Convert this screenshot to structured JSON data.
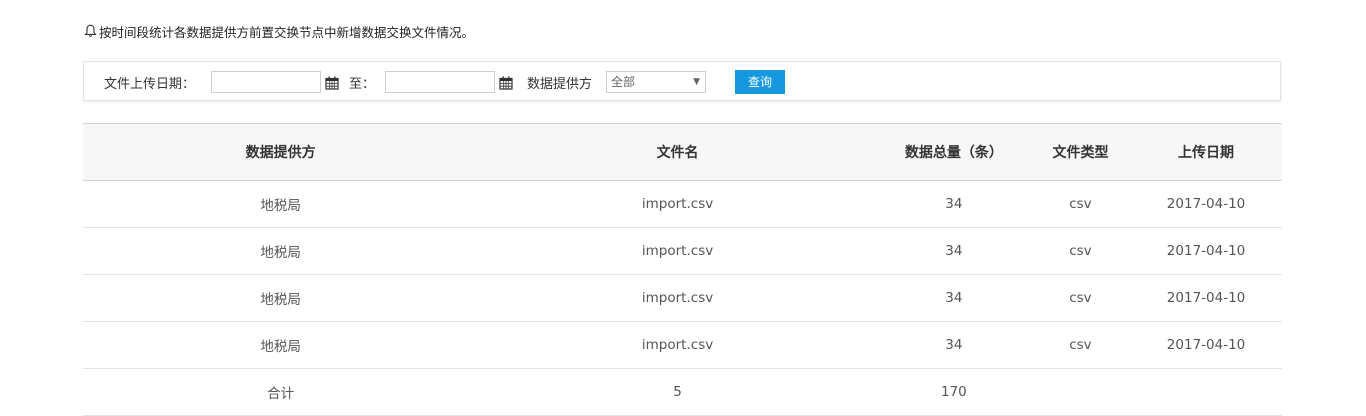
{
  "notice": {
    "icon": "bell-icon",
    "text": "按时间段统计各数据提供方前置交换节点中新增数据交换文件情况。"
  },
  "filter": {
    "upload_date_label": "文件上传日期：",
    "date_from_value": "",
    "to_label": "至：",
    "date_to_value": "",
    "provider_label": "数据提供方",
    "provider_selected": "全部",
    "query_button": "查询",
    "accent_color": "#1598e0"
  },
  "table": {
    "columns": [
      "数据提供方",
      "文件名",
      "数据总量（条）",
      "文件类型",
      "上传日期"
    ],
    "rows": [
      [
        "地税局",
        "import.csv",
        "34",
        "csv",
        "2017-04-10"
      ],
      [
        "地税局",
        "import.csv",
        "34",
        "csv",
        "2017-04-10"
      ],
      [
        "地税局",
        "import.csv",
        "34",
        "csv",
        "2017-04-10"
      ],
      [
        "地税局",
        "import.csv",
        "34",
        "csv",
        "2017-04-10"
      ]
    ],
    "total": {
      "label": "合计",
      "file_count": "5",
      "record_total": "170",
      "type": "",
      "date": ""
    }
  }
}
